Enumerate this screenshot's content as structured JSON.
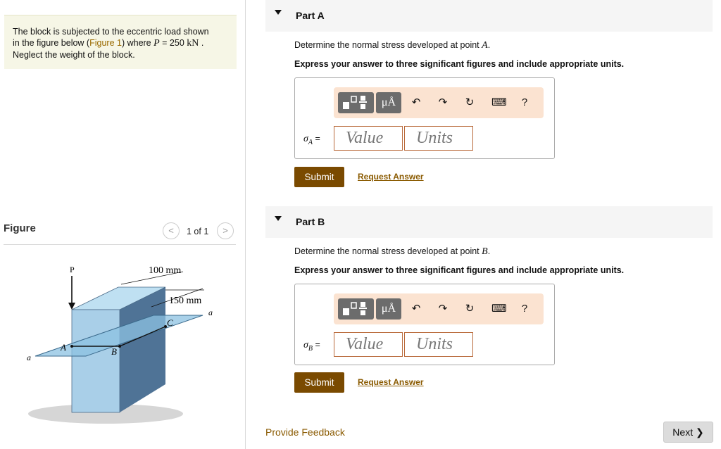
{
  "problem": {
    "line1": "The block is subjected to the eccentric load shown",
    "line2a": "in the figure below (",
    "figure_link": "Figure 1",
    "line2b": ") where ",
    "p_var": "P",
    "p_eq": " = 250 ",
    "p_unit": "kN",
    "line2c": " .",
    "line3": "Neglect the weight of the block."
  },
  "figure": {
    "title": "Figure",
    "pager": "1 of 1",
    "prev": "<",
    "next": ">",
    "labels": {
      "dim1": "100 mm",
      "dim2": "150 mm",
      "P": "P",
      "A": "A",
      "B": "B",
      "C": "C",
      "a_left": "a",
      "a_right": "a"
    }
  },
  "parts": [
    {
      "title": "Part A",
      "prompt_text": "Determine the normal stress developed at point ",
      "prompt_var": "A",
      "prompt_end": ".",
      "instruction": "Express your answer to three significant figures and include appropriate units.",
      "sigma": "σ",
      "sub": "A",
      "eq": " =",
      "value_placeholder": "Value",
      "units_placeholder": "Units",
      "submit": "Submit",
      "request": "Request Answer"
    },
    {
      "title": "Part B",
      "prompt_text": "Determine the normal stress developed at point ",
      "prompt_var": "B",
      "prompt_end": ".",
      "instruction": "Express your answer to three significant figures and include appropriate units.",
      "sigma": "σ",
      "sub": "B",
      "eq": " =",
      "value_placeholder": "Value",
      "units_placeholder": "Units",
      "submit": "Submit",
      "request": "Request Answer"
    }
  ],
  "toolbar": {
    "mu_label": "μÅ",
    "undo": "↶",
    "redo": "↷",
    "reset": "↻",
    "keyboard": "⌨",
    "help": "?"
  },
  "footer": {
    "feedback": "Provide Feedback",
    "next": "Next ❯"
  },
  "colors": {
    "accent_brown": "#7a4a00",
    "link_brown": "#8a5a00",
    "toolbar_bg": "#fbe3d1",
    "problem_bg": "#f6f6e6",
    "block_front": "#a9cfe8",
    "block_side": "#4f7396"
  }
}
